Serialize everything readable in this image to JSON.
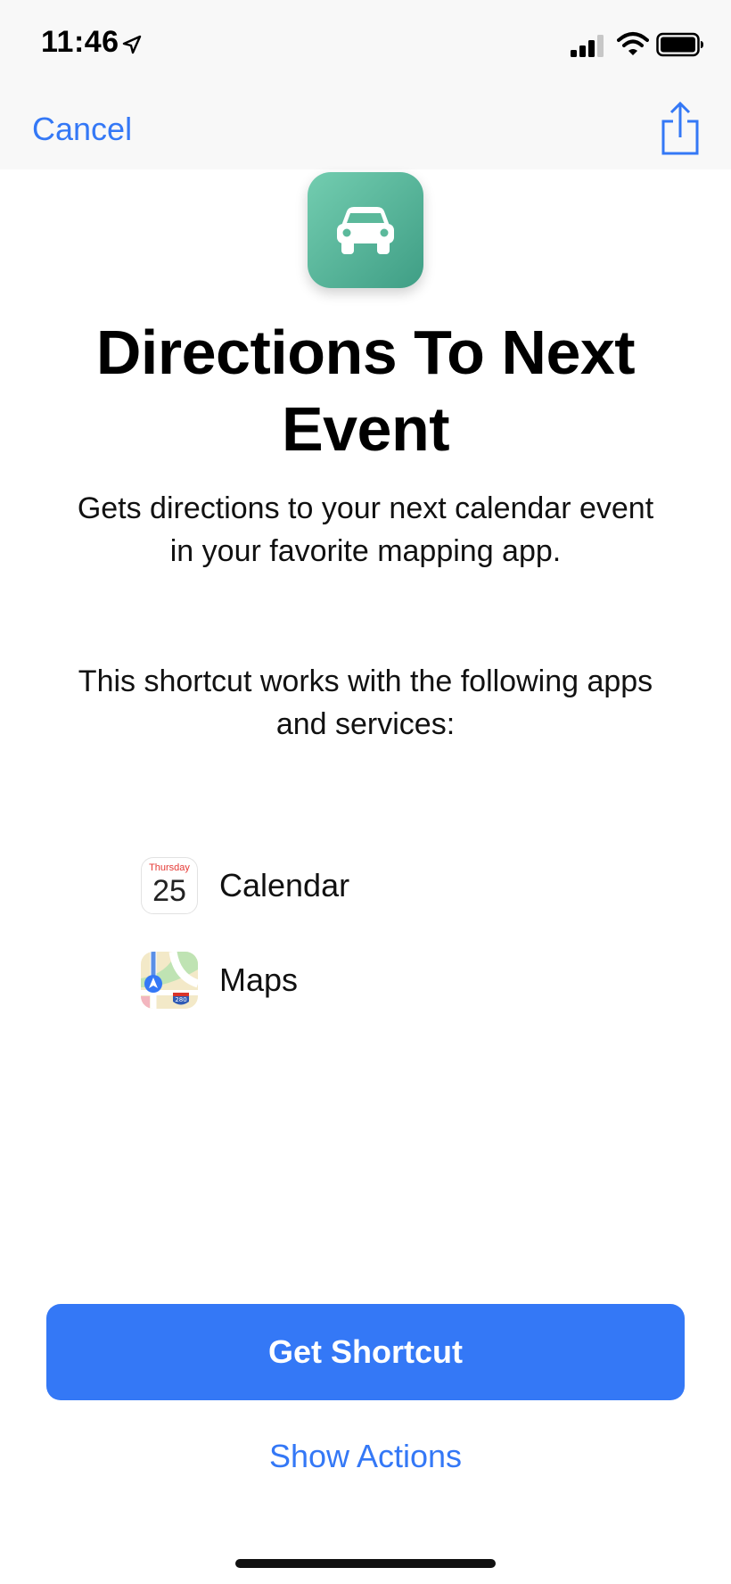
{
  "status_bar": {
    "time": "11:46",
    "icons": [
      "location-arrow-icon",
      "signal-icon",
      "wifi-icon",
      "battery-icon"
    ]
  },
  "nav": {
    "cancel_label": "Cancel",
    "share_icon": "share-icon"
  },
  "shortcut": {
    "icon": "car-icon",
    "icon_color": "#4fb394",
    "title": "Directions To Next Event",
    "description": "Gets directions to your next calendar event in your favorite mapping app."
  },
  "apps_section": {
    "heading": "This shortcut works with the following apps and services:",
    "apps": [
      {
        "name": "Calendar",
        "icon": "calendar-app-icon",
        "icon_day": "Thursday",
        "icon_date": "25"
      },
      {
        "name": "Maps",
        "icon": "maps-app-icon",
        "icon_badge": "280"
      }
    ]
  },
  "actions": {
    "primary_label": "Get Shortcut",
    "secondary_label": "Show Actions"
  },
  "colors": {
    "accent": "#3478f6",
    "background": "#ffffff"
  }
}
